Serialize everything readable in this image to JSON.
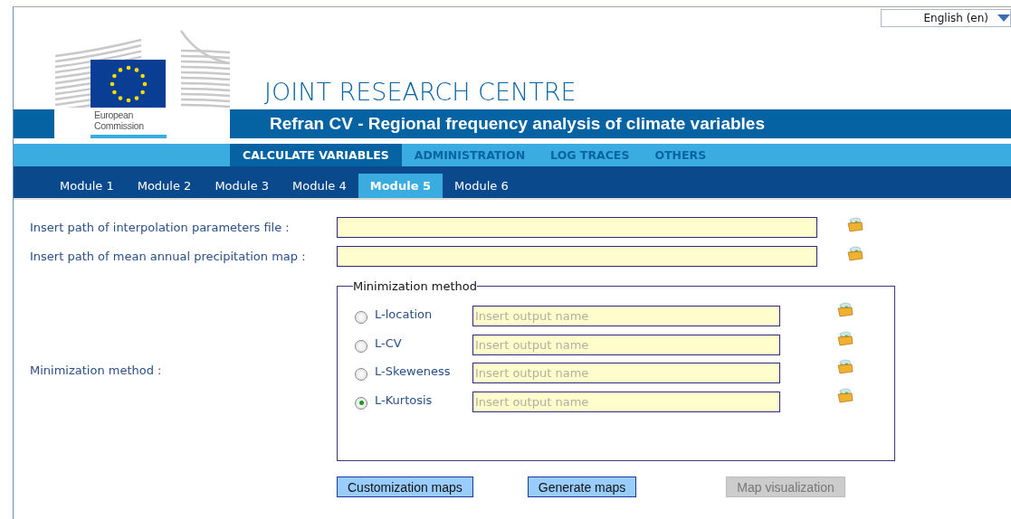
{
  "language_selector": {
    "value": "English (en)"
  },
  "header": {
    "logo_lines": [
      "European",
      "Commission"
    ],
    "title": "JOINT RESEARCH CENTRE",
    "subtitle": "Refran CV - Regional frequency analysis of climate variables"
  },
  "main_nav": [
    {
      "label": "CALCULATE VARIABLES",
      "selected": true
    },
    {
      "label": "ADMINISTRATION",
      "selected": false
    },
    {
      "label": "LOG TRACES",
      "selected": false
    },
    {
      "label": "OTHERS",
      "selected": false
    }
  ],
  "module_tabs": [
    {
      "label": "Module 1",
      "selected": false
    },
    {
      "label": "Module 2",
      "selected": false
    },
    {
      "label": "Module 3",
      "selected": false
    },
    {
      "label": "Module 4",
      "selected": false
    },
    {
      "label": "Module 5",
      "selected": true
    },
    {
      "label": "Module 6",
      "selected": false
    }
  ],
  "form": {
    "fields": [
      {
        "label": "Insert path of interpolation parameters file :"
      },
      {
        "label": "Insert path of mean annual precipitation map :"
      }
    ],
    "minimization": {
      "label": "Minimization method :",
      "legend": "Minimization method",
      "options": [
        {
          "label": "L-location",
          "selected": false,
          "placeholder": "Insert output name"
        },
        {
          "label": "L-CV",
          "selected": false,
          "placeholder": "Insert output name"
        },
        {
          "label": "L-Skeweness",
          "selected": false,
          "placeholder": "Insert output name"
        },
        {
          "label": "L-Kurtosis",
          "selected": true,
          "placeholder": "Insert output name"
        }
      ]
    },
    "buttons": [
      {
        "label": "Customization maps",
        "disabled": false
      },
      {
        "label": "Generate maps",
        "disabled": false
      },
      {
        "label": "Map visualization",
        "disabled": true
      }
    ]
  }
}
